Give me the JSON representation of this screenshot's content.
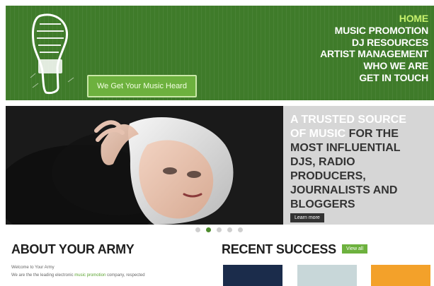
{
  "header": {
    "tagline": "We Get Your Music Heard",
    "nav": [
      "HOME",
      "MUSIC PROMOTION",
      "DJ RESOURCES",
      "ARTIST MANAGEMENT",
      "WHO WE ARE",
      "GET IN TOUCH"
    ]
  },
  "hero": {
    "promo_highlight": "A TRUSTED SOURCE OF MUSIC",
    "promo_rest": " FOR THE MOST INFLUENTIAL DJS, RADIO PRODUCERS, JOURNALISTS AND BLOGGERS",
    "button": "Learn more"
  },
  "about": {
    "title": "ABOUT YOUR ARMY",
    "line1": "Welcome to Your Army",
    "line2_prefix": "We are the the leading electronic ",
    "line2_link": "music promotion",
    "line2_suffix": " company, respected"
  },
  "recent": {
    "title": "RECENT SUCCESS",
    "view_all": "View all"
  },
  "colors": {
    "header_green": "#3f7b2a",
    "accent_green": "#6db13e",
    "active_nav": "#c6f06c"
  }
}
